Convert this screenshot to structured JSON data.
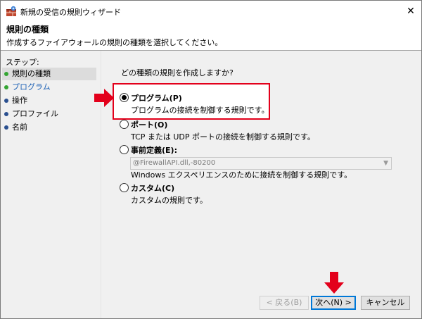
{
  "window": {
    "title": "新規の受信の規則ウィザード",
    "close_glyph": "✕"
  },
  "header": {
    "title": "規則の種類",
    "subtitle": "作成するファイアウォールの規則の種類を選択してください。"
  },
  "sidebar": {
    "steps_label": "ステップ:",
    "items": [
      {
        "label": "規則の種類",
        "state": "done"
      },
      {
        "label": "プログラム",
        "state": "current"
      },
      {
        "label": "操作",
        "state": "pending"
      },
      {
        "label": "プロファイル",
        "state": "pending"
      },
      {
        "label": "名前",
        "state": "pending"
      }
    ]
  },
  "main": {
    "question": "どの種類の規則を作成しますか?",
    "options": [
      {
        "title": "プログラム(P)",
        "desc": "プログラムの接続を制御する規則です。",
        "selected": true
      },
      {
        "title": "ポート(O)",
        "desc": "TCP または UDP ポートの接続を制御する規則です。",
        "selected": false
      },
      {
        "title": "事前定義(E):",
        "desc": "Windows エクスペリエンスのために接続を制御する規則です。",
        "selected": false
      },
      {
        "title": "カスタム(C)",
        "desc": "カスタムの規則です。",
        "selected": false
      }
    ],
    "predefined_select_value": "@FirewallAPI.dll,-80200"
  },
  "buttons": {
    "back": "< 戻る(B)",
    "next": "次へ(N) >",
    "cancel": "キャンセル"
  },
  "colors": {
    "accent_red": "#e3001b",
    "step_done": "#33a532",
    "step_current": "#1a5fb4",
    "step_pending": "#2a4f8f",
    "default_button_border": "#0078d7"
  }
}
